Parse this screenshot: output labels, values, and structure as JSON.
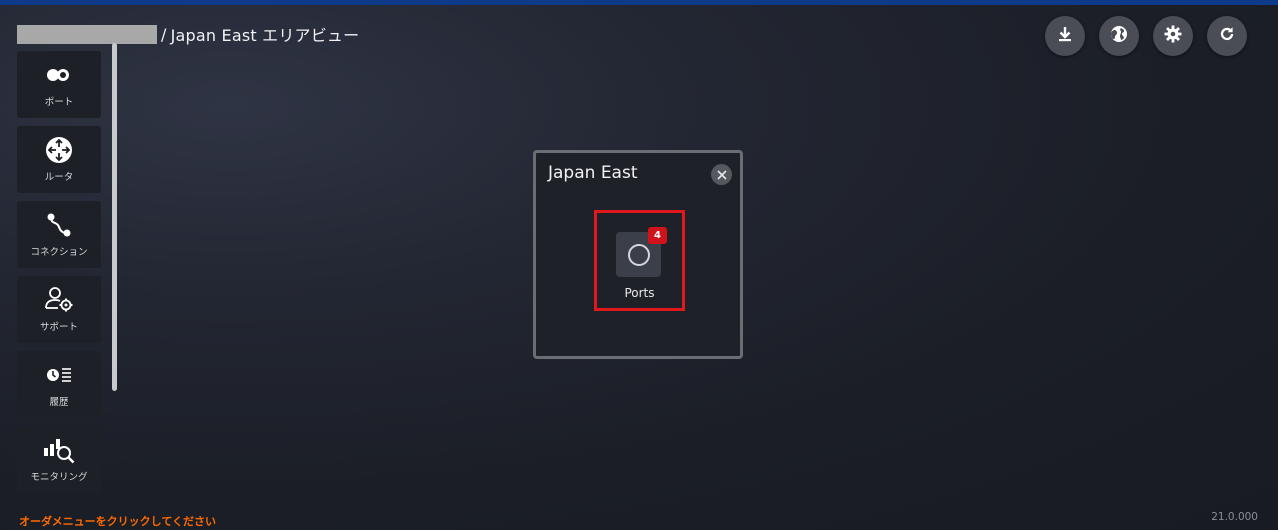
{
  "header": {
    "breadcrumb_sep": "/",
    "area_title": "Japan East エリアビュー"
  },
  "toolbar": {
    "buttons": [
      {
        "icon": "download-icon"
      },
      {
        "icon": "globe-icon"
      },
      {
        "icon": "gear-icon"
      },
      {
        "icon": "refresh-icon"
      }
    ]
  },
  "sidebar": {
    "items": [
      {
        "label": "ポート",
        "icon": "port-toggle-icon"
      },
      {
        "label": "ルータ",
        "icon": "router-icon"
      },
      {
        "label": "コネクション",
        "icon": "connection-icon"
      },
      {
        "label": "サポート",
        "icon": "support-user-gear-icon"
      },
      {
        "label": "履歴",
        "icon": "history-icon"
      },
      {
        "label": "モニタリング",
        "icon": "monitoring-icon"
      }
    ]
  },
  "panel": {
    "title": "Japan East",
    "ports": {
      "label": "Ports",
      "count": "4"
    }
  },
  "footer": {
    "message": "オーダメニューをクリックしてください",
    "version": "21.0.000"
  },
  "colors": {
    "accent_orange": "#ff6a00",
    "badge_red": "#d0121b",
    "highlight_red": "#e0191c",
    "top_strip": "#0e3a8a"
  }
}
